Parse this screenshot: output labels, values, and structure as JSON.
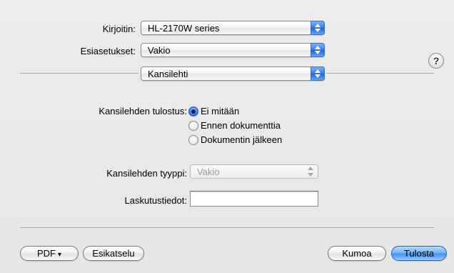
{
  "printer": {
    "label": "Kirjoitin:",
    "value": "HL-2170W series"
  },
  "presets": {
    "label": "Esiasetukset:",
    "value": "Vakio"
  },
  "panel": {
    "value": "Kansilehti"
  },
  "help_glyph": "?",
  "cover_print": {
    "label": "Kansilehden tulostus:",
    "options": [
      {
        "label": "Ei mitään",
        "selected": true
      },
      {
        "label": "Ennen dokumenttia",
        "selected": false
      },
      {
        "label": "Dokumentin jälkeen",
        "selected": false
      }
    ]
  },
  "cover_type": {
    "label": "Kansilehden tyyppi:",
    "value": "Vakio"
  },
  "billing": {
    "label": "Laskutustiedot:",
    "value": ""
  },
  "footer": {
    "pdf_label": "PDF",
    "pdf_caret": "▾",
    "preview_label": "Esikatselu",
    "cancel_label": "Kumoa",
    "print_label": "Tulosta"
  }
}
